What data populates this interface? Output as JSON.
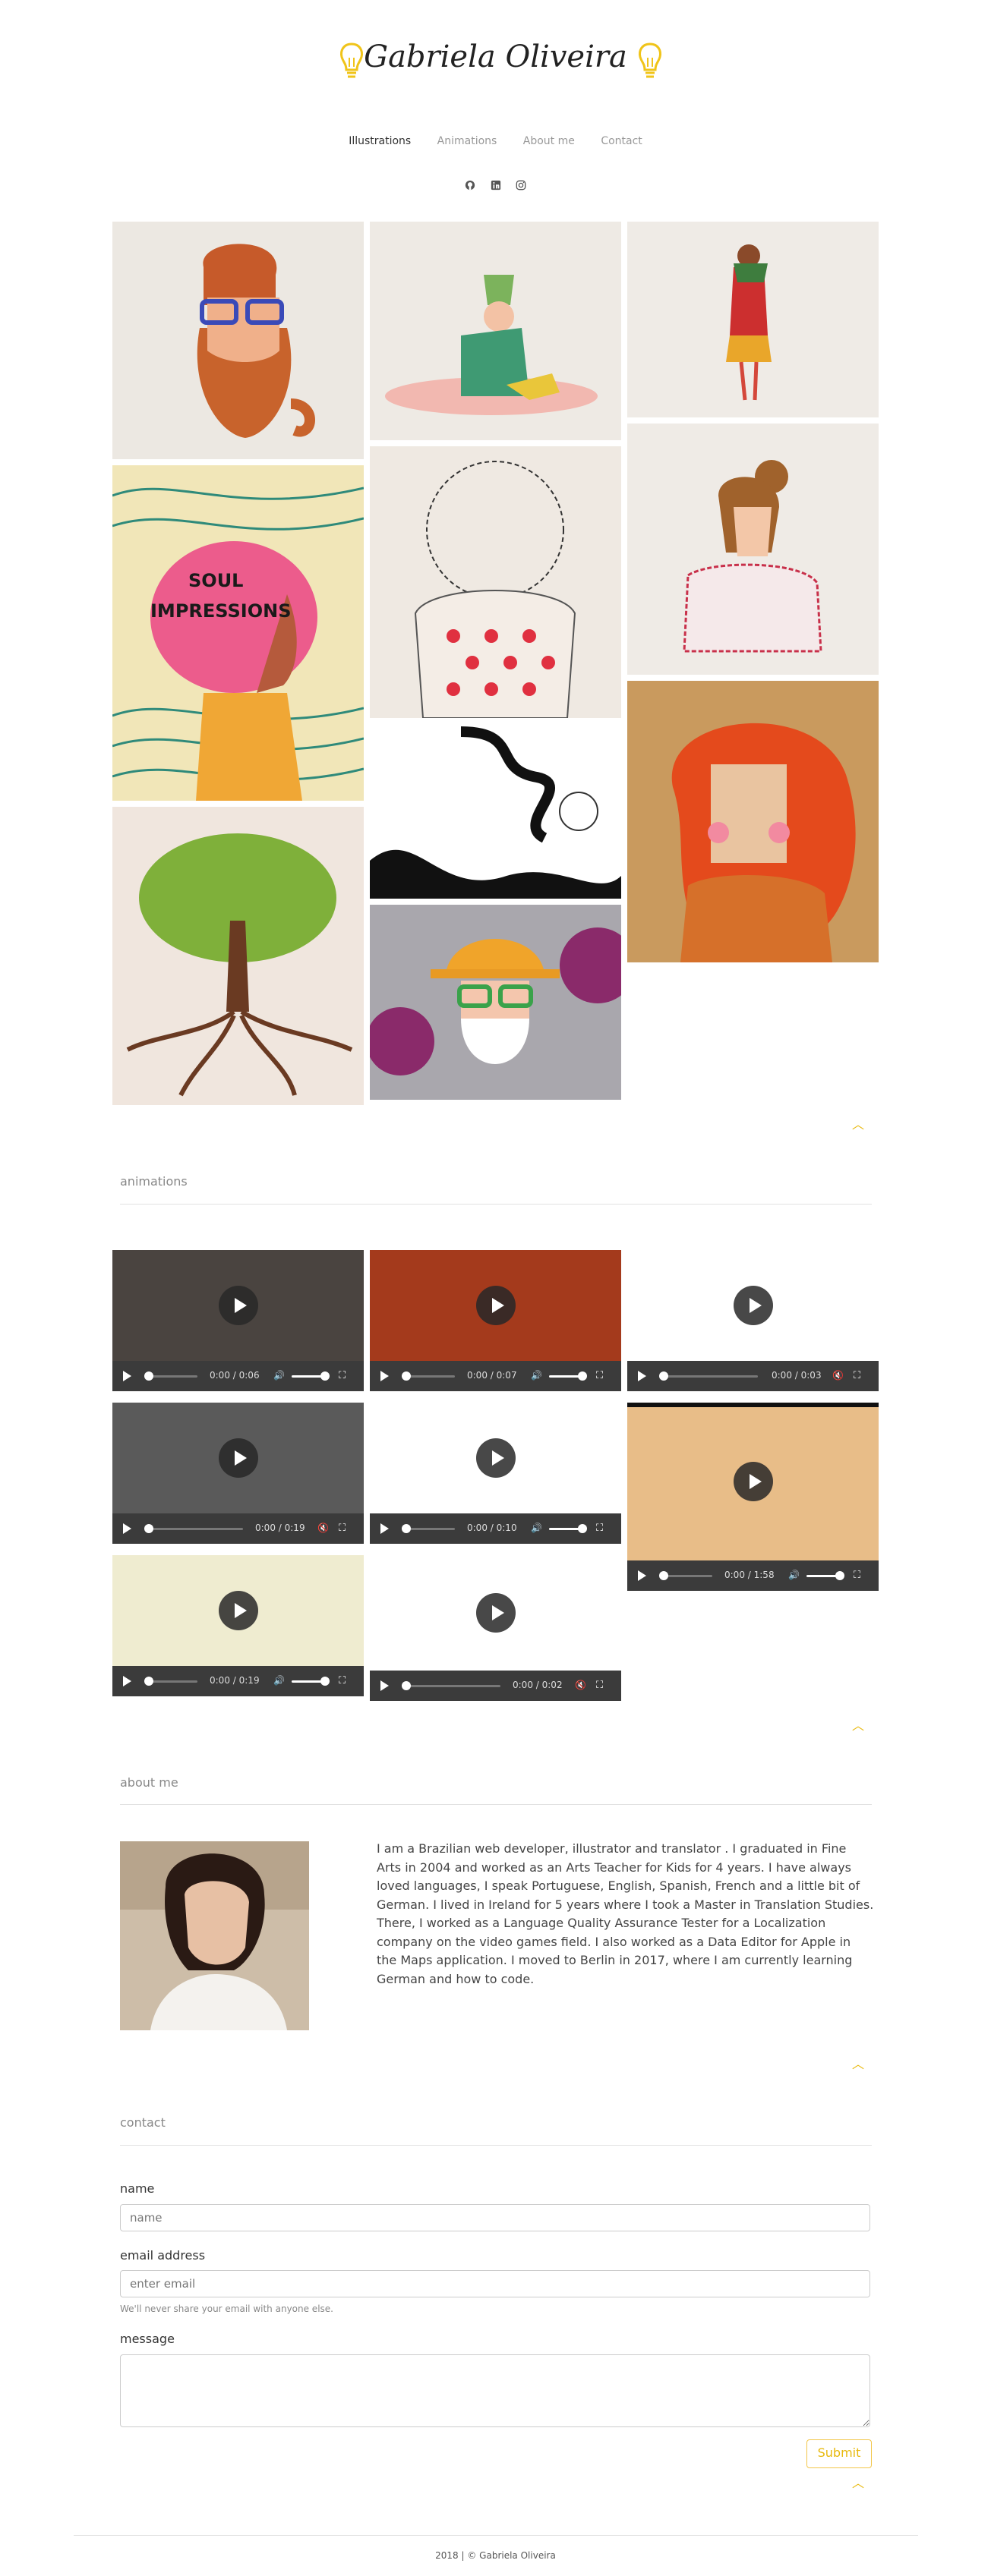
{
  "site_title": "Gabriela Oliveira",
  "nav": [
    {
      "label": "Illustrations",
      "active": true
    },
    {
      "label": "Animations",
      "active": false
    },
    {
      "label": "About me",
      "active": false
    },
    {
      "label": "Contact",
      "active": false
    }
  ],
  "social_icons": [
    "github-icon",
    "linkedin-icon",
    "instagram-icon"
  ],
  "gallery_tile_count": 11,
  "gallery_labels": {
    "soul_text_1": "SOUL",
    "soul_text_2": "IMPRESSIONS"
  },
  "sections": {
    "animations": "animations",
    "about": "about me",
    "contact": "contact"
  },
  "videos": [
    {
      "current": "0:00",
      "duration": "0:06",
      "muted": false
    },
    {
      "current": "0:00",
      "duration": "0:07",
      "muted": false
    },
    {
      "current": "0:00",
      "duration": "0:03",
      "muted": true
    },
    {
      "current": "0:00",
      "duration": "0:19",
      "muted": true
    },
    {
      "current": "0:00",
      "duration": "0:10",
      "muted": false
    },
    {
      "current": "0:00",
      "duration": "1:58",
      "muted": false
    },
    {
      "current": "0:00",
      "duration": "0:19",
      "muted": false
    },
    {
      "current": "0:00",
      "duration": "0:02",
      "muted": true
    }
  ],
  "about_text": "I am a Brazilian web developer, illustrator and translator . I graduated in Fine Arts in 2004 and worked as an Arts Teacher for Kids for 4 years. I have always loved languages, I speak Portuguese, English, Spanish, French and a little bit of German. I lived in Ireland for 5 years where I took a Master in Translation Studies. There, I worked as a Language Quality Assurance Tester for a Localization company on the video games field. I also worked as a Data Editor for Apple in the Maps application. I moved to Berlin in 2017, where I am currently learning German and how to code.",
  "contact_form": {
    "name_label": "name",
    "name_placeholder": "name",
    "email_label": "email address",
    "email_placeholder": "enter email",
    "email_help": "We'll never share your email with anyone else.",
    "message_label": "message",
    "submit_label": "Submit"
  },
  "footer": "2018 | © Gabriela Oliveira",
  "colors": {
    "accent": "#e8b90c",
    "text": "#333333",
    "muted": "#888888"
  }
}
